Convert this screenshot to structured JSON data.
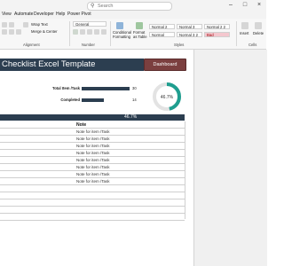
{
  "titlebar": {
    "search_icon": "magnifier-icon",
    "search_placeholder": "Search"
  },
  "menu": [
    "View",
    "Automate",
    "Developer",
    "Help",
    "Power Pivot"
  ],
  "ribbon": {
    "font_name": "Century",
    "wrap_text": "Wrap Text",
    "merge_center": "Merge & Center",
    "number_format": "General",
    "conditional_formatting": "Conditional Formatting",
    "format_as_table": "Format as Table",
    "styles": [
      {
        "label": "Normal 2",
        "bg": "#ffffff"
      },
      {
        "label": "Normal 3",
        "bg": "#ffffff"
      },
      {
        "label": "Normal 2 2",
        "bg": "#ffffff"
      },
      {
        "label": "Normal",
        "bg": "#ffffff"
      },
      {
        "label": "Normal 3 2",
        "bg": "#ffffff"
      },
      {
        "label": "Bad",
        "bg": "#f4c7ce"
      }
    ],
    "insert": "Insert",
    "delete": "Delete",
    "group_alignment": "Alignment",
    "group_number": "Number",
    "group_styles": "Styles",
    "group_cells": "Cells"
  },
  "sheet": {
    "title": "Checklist Excel Template",
    "dashboard_button": "Dashboard",
    "total_label": "Total Item /Task",
    "total_value": "30",
    "completed_label": "Completed",
    "completed_value": "14",
    "completed_fraction": 0.467,
    "percent_text": "46.7%",
    "band_text": "46.7%",
    "note_header": "Note",
    "note_rows": [
      "Note for item /Task",
      "Note for item /Task",
      "Note for item /Task",
      "Note for item /Task",
      "Note for item /Task",
      "Note for item /Task",
      "Note for item /Task",
      "Note for item /Task",
      "",
      "",
      "",
      "",
      ""
    ],
    "colors": {
      "navy": "#2c3e50",
      "accent": "#1f9e8f",
      "button": "#7b3f3f"
    }
  }
}
